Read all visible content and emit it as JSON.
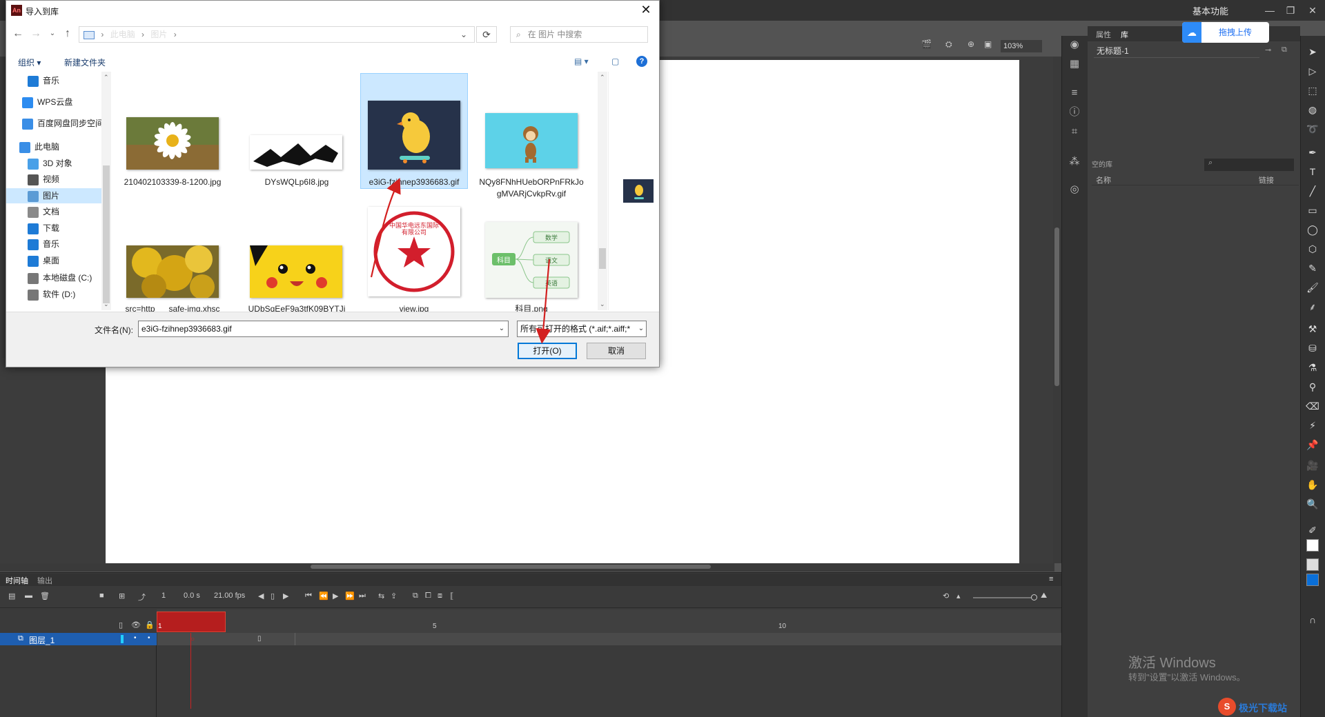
{
  "app": {
    "workspace_label": "基本功能",
    "zoom": "103%",
    "panel_tabs": [
      "属性",
      "库"
    ],
    "baidu_upload": "拖拽上传",
    "document_select": "无标题-1",
    "library_empty_label": "空的库",
    "library_columns": [
      "名称",
      "链接"
    ],
    "timeline_tabs": [
      "时间轴",
      "输出"
    ],
    "timeline": {
      "frame_number": "1",
      "time": "0.0 s",
      "fps": "21.00 fps",
      "ruler_marks": [
        "1",
        "5",
        "10"
      ],
      "layer_name": "图层_1"
    }
  },
  "dialog": {
    "title": "导入到库",
    "title_icon": "An",
    "breadcrumb": [
      "此电脑",
      "图片"
    ],
    "search_placeholder": "在 图片 中搜索",
    "commands": {
      "organize": "组织 ▾",
      "new_folder": "新建文件夹"
    },
    "nav_items": [
      {
        "label": "音乐",
        "icon": "music-icon",
        "color": "#1e7bd6"
      },
      {
        "label": "WPS云盘",
        "icon": "cloud-icon",
        "color": "#2d8cf0"
      },
      {
        "label": "百度网盘同步空间",
        "icon": "baidu-drive-icon",
        "color": "#3a8ee6"
      },
      {
        "label": "此电脑",
        "icon": "computer-icon",
        "color": "#3a8ee6"
      },
      {
        "label": "3D 对象",
        "icon": "cube-icon",
        "color": "#49a0e8"
      },
      {
        "label": "视频",
        "icon": "video-icon",
        "color": "#555555"
      },
      {
        "label": "图片",
        "icon": "pictures-icon",
        "color": "#5b9bd5"
      },
      {
        "label": "文档",
        "icon": "document-icon",
        "color": "#8a8a8a"
      },
      {
        "label": "下载",
        "icon": "download-icon",
        "color": "#1e7bd6"
      },
      {
        "label": "音乐",
        "icon": "music-icon",
        "color": "#1e7bd6"
      },
      {
        "label": "桌面",
        "icon": "desktop-icon",
        "color": "#1e7bd6"
      },
      {
        "label": "本地磁盘 (C:)",
        "icon": "drive-icon",
        "color": "#777777"
      },
      {
        "label": "软件 (D:)",
        "icon": "drive-icon",
        "color": "#777777"
      }
    ],
    "files": [
      {
        "name": "210402103339-8-1200.jpg",
        "thumb": "daisy"
      },
      {
        "name": "DYsWQLp6I8.jpg",
        "thumb": "brush-stroke"
      },
      {
        "name": "e3iG-fzihnep3936683.gif",
        "thumb": "chick",
        "selected": true
      },
      {
        "name": "NQy8FNhHUebORPnFRkJogMVARjCvkpRv.gif",
        "thumb": "monkey"
      },
      {
        "name": "src=http___safe-img.xhsc",
        "thumb": "ginkgo"
      },
      {
        "name": "UDbSqEeF9a3tfK09BYTJj",
        "thumb": "pikachu"
      },
      {
        "name": "view.jpg",
        "thumb": "red-seal"
      },
      {
        "name": "科目.png",
        "thumb": "mindmap"
      }
    ],
    "seal_text": "中国华电远东国际有限公司",
    "mindmap": {
      "root": "科目",
      "branches": [
        "数学",
        "语文",
        "英语"
      ]
    },
    "filename_label": "文件名(N):",
    "filename_value": "e3iG-fzihnep3936683.gif",
    "filter_value": "所有可打开的格式 (*.aif;*.aiff;*",
    "open_label": "打开(O)",
    "cancel_label": "取消"
  },
  "watermark": {
    "line1": "激活 Windows",
    "line2": "转到\"设置\"以激活 Windows。"
  },
  "site_logo": "极光下载站"
}
